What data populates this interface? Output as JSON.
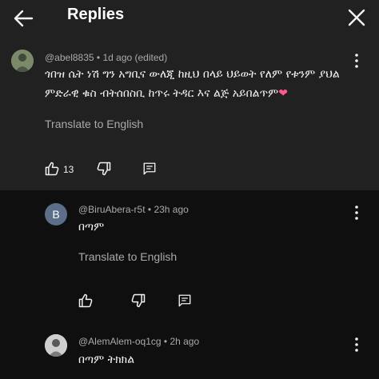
{
  "header": {
    "title": "Replies",
    "back_icon": "arrow-left-icon",
    "close_icon": "close-icon"
  },
  "comments": [
    {
      "author": "@abel8835",
      "time": "1d ago (edited)",
      "text": "ጎበዝ ሴት ነሽ ግን አግቢና ውለጂ ከዚህ በላይ ህይወት የለም የቱንም ያህል ምድራዊ ቁስ ብትሰበስቢ ከጥሩ ትዳር እና ልጅ አይበልጥም",
      "emoji": "❤",
      "translate": "Translate to English",
      "likes": "13"
    },
    {
      "author": "@BiruAbera-r5t",
      "time": "23h ago",
      "avatar_letter": "B",
      "text": "በጣም",
      "translate": "Translate to English"
    },
    {
      "author": "@AlemAlem-oq1cg",
      "time": "2h ago",
      "text": "በጣም ትክክል"
    }
  ],
  "colors": {
    "background": "#0f0f0f",
    "header_bg": "#212121",
    "avatar_b": "#5c6e8a",
    "heart": "#ff5a8a"
  }
}
